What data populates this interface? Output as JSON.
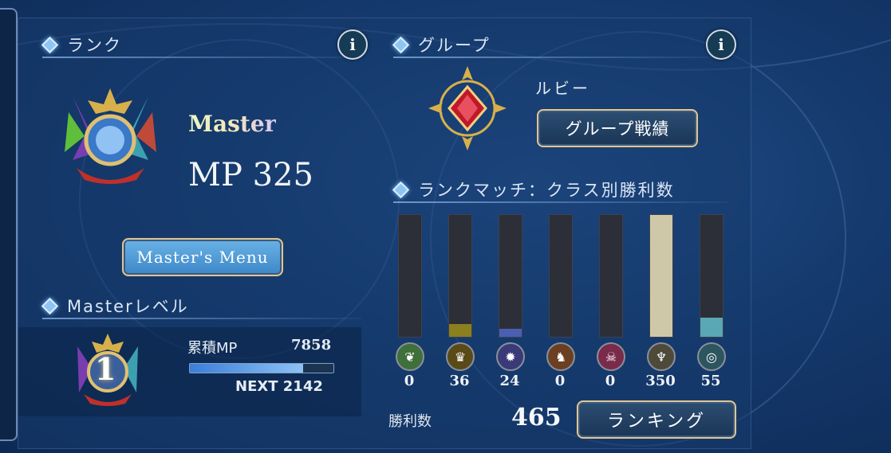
{
  "rank_section": {
    "title": "ランク",
    "info": "i",
    "rank_name": "Master",
    "mp_label": "MP 325",
    "menu_button": "Master's Menu"
  },
  "master_level": {
    "title": "Masterレベル",
    "level": "1",
    "cumulative_label": "累積MP",
    "cumulative_value": "7858",
    "next_label": "NEXT 2142",
    "progress_percent": 79
  },
  "group_section": {
    "title": "グループ",
    "info": "i",
    "group_name": "ルビー",
    "record_button": "グループ戦績"
  },
  "class_wins": {
    "title": "ランクマッチ：クラス別勝利数",
    "max_value": 350,
    "classes": [
      {
        "icon": "forest-leaf-icon",
        "value": "0",
        "num": 0,
        "color": "#2c2f38",
        "icon_bg": "#3f6f3a",
        "glyph": "❦"
      },
      {
        "icon": "sword-crown-icon",
        "value": "36",
        "num": 36,
        "color": "#8b7f1e",
        "icon_bg": "#5a4a18",
        "glyph": "♛"
      },
      {
        "icon": "rune-star-icon",
        "value": "24",
        "num": 24,
        "color": "#4b5fb0",
        "icon_bg": "#3a3a78",
        "glyph": "✹"
      },
      {
        "icon": "dragon-icon",
        "value": "0",
        "num": 0,
        "color": "#2c2f38",
        "icon_bg": "#6b3f22",
        "glyph": "♞"
      },
      {
        "icon": "shadow-skull-icon",
        "value": "0",
        "num": 0,
        "color": "#2c2f38",
        "icon_bg": "#7a2a4a",
        "glyph": "☠"
      },
      {
        "icon": "blood-fang-icon",
        "value": "350",
        "num": 350,
        "color": "#cfc8a8",
        "icon_bg": "#4e4a3a",
        "glyph": "♆"
      },
      {
        "icon": "haven-spiral-icon",
        "value": "55",
        "num": 55,
        "color": "#5aa7b5",
        "icon_bg": "#2d5560",
        "glyph": "◎"
      }
    ],
    "wins_label": "勝利数",
    "wins_total": "465",
    "ranking_button": "ランキング"
  }
}
